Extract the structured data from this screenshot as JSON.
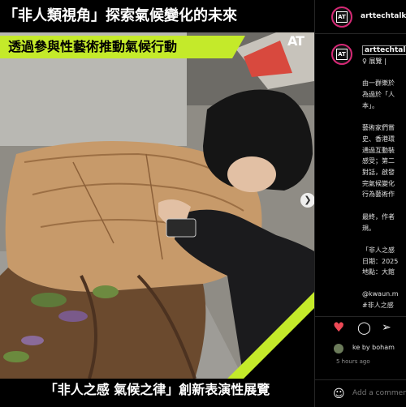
{
  "post": {
    "headline": "「非人類視角」探索氣候變化的未來",
    "subheadline": "透過參與性藝術推動氣候行動",
    "logo_text": "AT",
    "caption": "「非人之感 氣候之律」創新表演性展覽",
    "next_icon": "chevron-right-icon"
  },
  "sidebar": {
    "account": "arttechtalk",
    "caption_user": "arttechtalk",
    "caption_lines": [
      "♀ 展覽 |",
      "",
      "由一群樂於",
      "為過於「人",
      "本」。",
      "",
      "藝術家們嘗",
      "史、香港環",
      "通過互動裝",
      "感受；第二",
      "對話，啟發",
      "完氣候變化",
      "行為藝術作",
      "",
      "最終，作者",
      "規。",
      "",
      "「非人之感",
      "日期：2025",
      "地點：大館",
      "",
      "@kwaun.m",
      "#非人之感"
    ],
    "liked_by": "ke by boham",
    "time": "5 hours ago",
    "comment_placeholder": "Add a comment..."
  },
  "colors": {
    "accent": "#c4ea2a",
    "like": "#ed4956",
    "story_ring": "#d62976"
  }
}
